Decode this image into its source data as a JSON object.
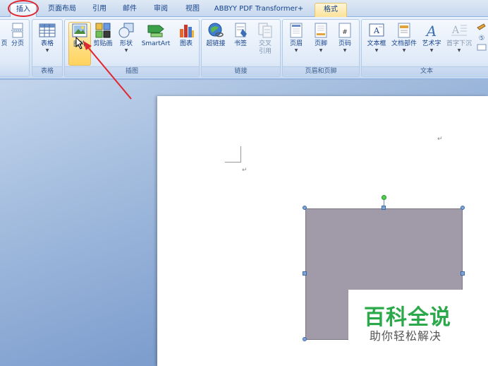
{
  "tabs": [
    {
      "label": "插入",
      "active": true
    },
    {
      "label": "页面布局"
    },
    {
      "label": "引用"
    },
    {
      "label": "邮件"
    },
    {
      "label": "审阅"
    },
    {
      "label": "视图"
    },
    {
      "label": "ABBYY PDF Transformer+"
    },
    {
      "label": "格式"
    }
  ],
  "groups": {
    "pages": {
      "btn_page_break": "分页",
      "btn_page_left": "页"
    },
    "tables": {
      "label": "表格",
      "btn_table": "表格"
    },
    "illustrations": {
      "label": "插图",
      "btn_picture": "图片",
      "btn_clipart": "剪贴画",
      "btn_shapes": "形状",
      "btn_smartart": "SmartArt",
      "btn_chart": "图表"
    },
    "links": {
      "label": "链接",
      "btn_hyperlink": "超链接",
      "btn_bookmark": "书签",
      "btn_crossref_1": "交叉",
      "btn_crossref_2": "引用"
    },
    "header_footer": {
      "label": "页眉和页脚",
      "btn_header": "页眉",
      "btn_footer": "页脚",
      "btn_page_number": "页码"
    },
    "text": {
      "label": "文本",
      "btn_textbox": "文本框",
      "btn_quickparts": "文档部件",
      "btn_wordart": "艺术字",
      "btn_dropcap": "首字下沉"
    }
  },
  "document": {
    "para_mark": "↵"
  },
  "watermark": {
    "title": "百科全说",
    "subtitle": "助你轻松解决"
  },
  "colors": {
    "accent_red": "#e0262e",
    "shape_fill": "#a19aa8",
    "watermark_green": "#2ba84a"
  }
}
